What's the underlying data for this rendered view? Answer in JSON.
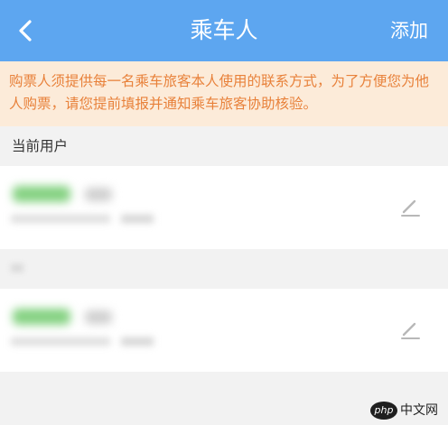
{
  "header": {
    "title": "乘车人",
    "action_label": "添加"
  },
  "notice": {
    "text": "购票人须提供每一名乘车旅客本人使用的联系方式，为了方便您为他人购票，请您提前填报并通知乘车旅客协助核验。"
  },
  "current_user_section": {
    "title": "当前用户"
  },
  "watermark": {
    "logo_text": "php",
    "site_text": "中文网"
  },
  "colors": {
    "header_bg": "#5da6f0",
    "notice_bg": "#fcebd9",
    "notice_text": "#e8813a",
    "page_bg": "#f2f2f2"
  },
  "icons": [
    "back-arrow-icon",
    "edit-pencil-icon"
  ]
}
